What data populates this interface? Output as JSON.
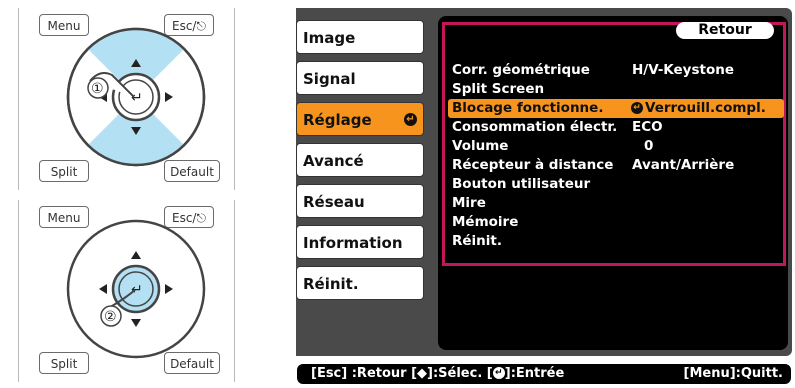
{
  "remote_top": {
    "menu": "Menu",
    "esc": "Esc/",
    "split": "Split",
    "default": "Default",
    "step": "①"
  },
  "remote_bottom": {
    "menu": "Menu",
    "esc": "Esc/",
    "split": "Split",
    "default": "Default",
    "step": "②"
  },
  "left_menu": [
    {
      "label": "Image"
    },
    {
      "label": "Signal"
    },
    {
      "label": "Réglage"
    },
    {
      "label": "Avancé"
    },
    {
      "label": "Réseau"
    },
    {
      "label": "Information"
    },
    {
      "label": "Réinit."
    }
  ],
  "submenu": {
    "retour": "Retour",
    "rows": [
      {
        "label": "Corr. géométrique",
        "value": "H/V-Keystone"
      },
      {
        "label": "Split Screen",
        "value": ""
      },
      {
        "label": "Blocage fonctionne.",
        "value": "Verrouill.compl."
      },
      {
        "label": "Consommation électr.",
        "value": "ECO"
      },
      {
        "label": "Volume",
        "value": "0"
      },
      {
        "label": "Récepteur à distance",
        "value": "Avant/Arrière"
      },
      {
        "label": "Bouton utilisateur",
        "value": ""
      },
      {
        "label": "Mire",
        "value": ""
      },
      {
        "label": "Mémoire",
        "value": ""
      },
      {
        "label": "Réinit.",
        "value": ""
      }
    ]
  },
  "footer": {
    "left": "[Esc] :Retour  [◆]:Sélec. [",
    "mid": "]:Entrée",
    "right": "[Menu]:Quitt."
  },
  "colors": {
    "accent": "#f7941d",
    "highlight_border": "#c2185b",
    "dpad_highlight": "#b3e0f2"
  }
}
